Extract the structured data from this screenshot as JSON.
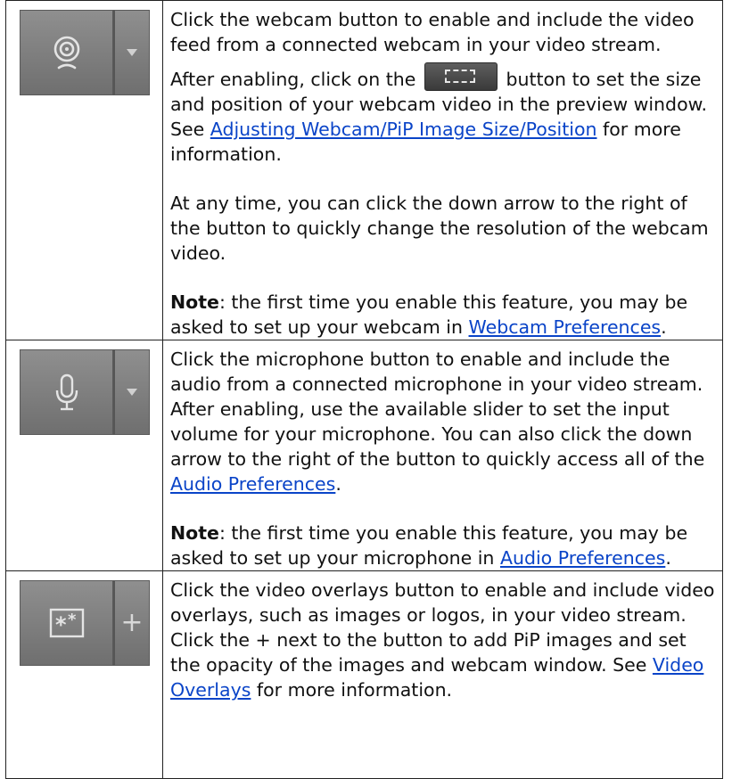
{
  "rows": [
    {
      "button": {
        "icon": "webcam-icon",
        "side": "chevron-down-icon"
      },
      "p1": "Click the webcam button to enable and include the video feed from a connected webcam in your video stream.",
      "p2_a": "After enabling, click on the",
      "p2_button_icon": "resize-frame-icon",
      "p2_b": "button to set the size and position of your webcam video in the preview window. See",
      "p2_link": "Adjusting Webcam/PiP Image Size/Position",
      "p2_c": "for more information.",
      "p3": "At any time, you can click the down arrow to the right of the button to quickly change the resolution of the webcam video.",
      "note_label": "Note",
      "note_a": ": the first time you enable this feature, you may be asked to set up your webcam in",
      "note_link": "Webcam Preferences",
      "note_end": "."
    },
    {
      "button": {
        "icon": "microphone-icon",
        "side": "chevron-down-icon"
      },
      "p1_a": "Click the microphone button to enable and include the audio from a connected microphone in your video stream. After enabling, use the available slider to set the input volume for your microphone. You can also click the down arrow to the right of the button to quickly access all of the",
      "p1_link": "Audio Preferences",
      "p1_end": ".",
      "note_label": "Note",
      "note_a": ": the first time you enable this feature, you may be asked to set up your microphone in",
      "note_link": "Audio Preferences",
      "note_end": "."
    },
    {
      "button": {
        "icon": "video-overlay-icon",
        "side": "+"
      },
      "p1_a": "Click the video overlays button to enable and include video overlays, such as images or logos, in your video stream. Click the + next to the button to add PiP images and set the opacity of the images and webcam window. See",
      "p1_link": "Video Overlays",
      "p1_end": "for more information."
    }
  ],
  "colors": {
    "link": "#0a44c8",
    "button_bg": "#7f7f7f",
    "icon": "#e4e4e4"
  }
}
